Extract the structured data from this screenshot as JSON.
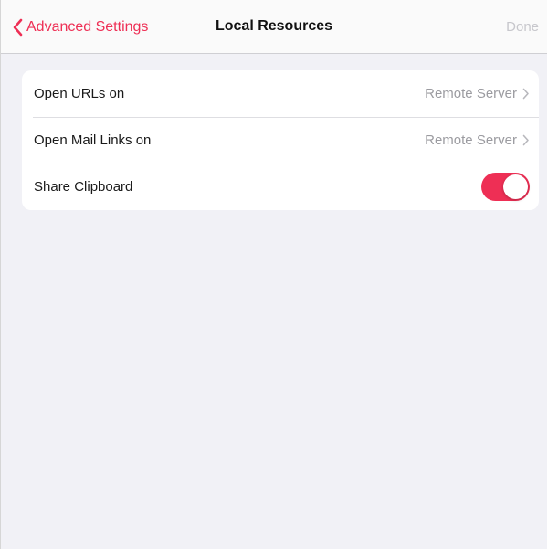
{
  "header": {
    "back_label": "Advanced Settings",
    "title": "Local Resources",
    "done_label": "Done"
  },
  "settings": [
    {
      "label": "Open URLs on",
      "value": "Remote Server"
    },
    {
      "label": "Open Mail Links on",
      "value": "Remote Server"
    },
    {
      "label": "Share Clipboard",
      "toggle_on": true
    }
  ],
  "colors": {
    "accent": "#ee2f55",
    "background": "#f1f1f6",
    "secondary_text": "#9b9ba0",
    "disabled_text": "#c7c7cc"
  },
  "icons": {
    "back": "chevron-left-icon",
    "disclosure": "chevron-right-icon"
  }
}
